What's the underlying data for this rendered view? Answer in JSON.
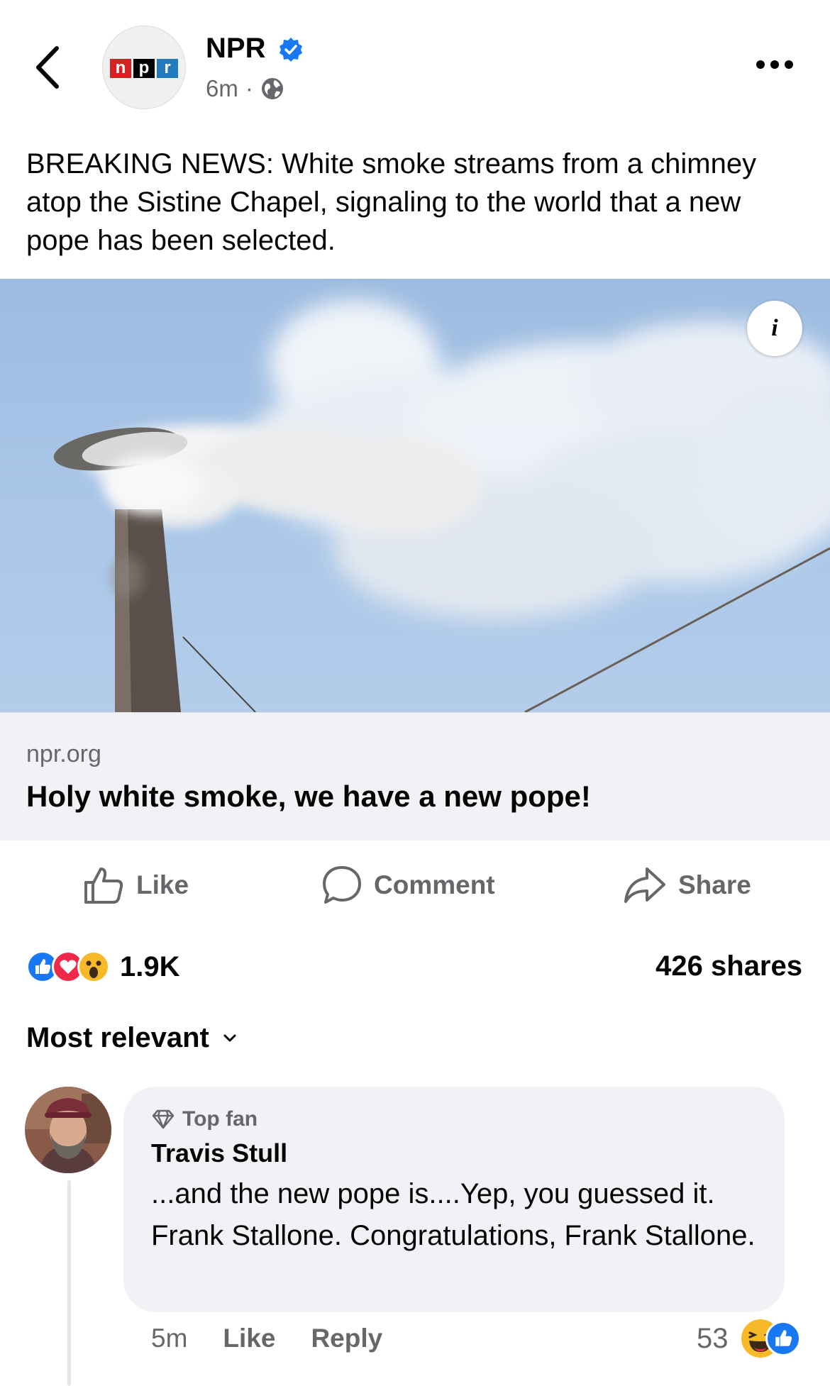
{
  "header": {
    "page_name": "NPR",
    "logo_letters": [
      "n",
      "p",
      "r"
    ],
    "time": "6m",
    "separator": "·",
    "visibility_icon": "globe-icon",
    "more_icon": "more-dots-icon",
    "back_icon": "chevron-left-icon",
    "verified_icon": "verified-badge-icon"
  },
  "post": {
    "text": "BREAKING NEWS: White smoke streams from a chimney atop the Sistine Chapel, signaling to the world that a new pope has been selected.",
    "info_label": "i"
  },
  "link": {
    "domain": "npr.org",
    "title": "Holy white smoke, we have a new pope!"
  },
  "actions": {
    "like": "Like",
    "comment": "Comment",
    "share": "Share"
  },
  "stats": {
    "reaction_icons": [
      "like-reaction-icon",
      "love-reaction-icon",
      "wow-reaction-icon"
    ],
    "reaction_count": "1.9K",
    "shares": "426 shares"
  },
  "sort": {
    "label": "Most relevant"
  },
  "comment": {
    "badge": "Top fan",
    "name": "Travis Stull",
    "text": "...and the new pope is....Yep, you guessed it. Frank Stallone. Congratulations, Frank Stallone.",
    "time": "5m",
    "like": "Like",
    "reply": "Reply",
    "reaction_count": "53",
    "reaction_icons": [
      "haha-reaction-icon",
      "like-reaction-icon"
    ]
  },
  "colors": {
    "npr_red": "#d62021",
    "npr_black": "#000000",
    "npr_blue": "#237bbd",
    "facebook_blue": "#1877f2",
    "secondary_text": "#65676b",
    "love_red": "#f02849",
    "reaction_yellow": "#f7b928"
  }
}
